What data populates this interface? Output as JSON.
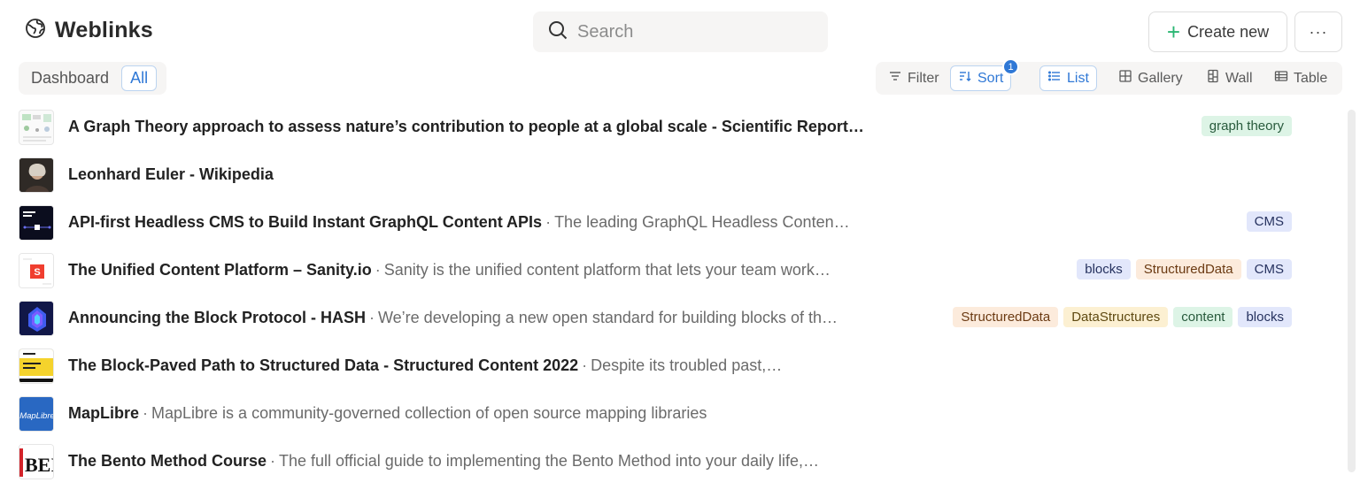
{
  "header": {
    "title": "Weblinks",
    "search_placeholder": "Search",
    "create_label": "Create new",
    "more_label": "···"
  },
  "views": {
    "tabs": [
      {
        "label": "Dashboard",
        "active": false
      },
      {
        "label": "All",
        "active": true
      }
    ]
  },
  "toolbar": {
    "filter_label": "Filter",
    "sort_label": "Sort",
    "sort_count": "1",
    "list_label": "List",
    "gallery_label": "Gallery",
    "wall_label": "Wall",
    "table_label": "Table"
  },
  "links": [
    {
      "title": "A Graph Theory approach to assess nature’s contribution to people at a global scale - Scientific Report…",
      "description": "",
      "tags": [
        {
          "label": "graph theory",
          "color": "green"
        }
      ]
    },
    {
      "title": "Leonhard Euler - Wikipedia",
      "description": "",
      "tags": []
    },
    {
      "title": "API-first Headless CMS to Build Instant GraphQL Content APIs",
      "description": "The leading GraphQL Headless Conten…",
      "tags": [
        {
          "label": "CMS",
          "color": "blue"
        }
      ]
    },
    {
      "title": "The Unified Content Platform – Sanity.io",
      "description": "Sanity is the unified content platform that lets your team work…",
      "tags": [
        {
          "label": "blocks",
          "color": "blue"
        },
        {
          "label": "StructuredData",
          "color": "orange"
        },
        {
          "label": "CMS",
          "color": "blue"
        }
      ]
    },
    {
      "title": "Announcing the Block Protocol - HASH",
      "description": "We’re developing a new open standard for building blocks of th…",
      "tags": [
        {
          "label": "StructuredData",
          "color": "orange"
        },
        {
          "label": "DataStructures",
          "color": "yellow"
        },
        {
          "label": "content",
          "color": "green"
        },
        {
          "label": "blocks",
          "color": "blue"
        }
      ]
    },
    {
      "title": "The Block-Paved Path to Structured Data - Structured Content 2022",
      "description": "Despite its troubled past,…",
      "tags": []
    },
    {
      "title": "MapLibre",
      "description": "MapLibre is a community-governed collection of open source mapping libraries",
      "tags": []
    },
    {
      "title": "The Bento Method Course",
      "description": "The full official guide to implementing the Bento Method into your daily life,…",
      "tags": []
    }
  ],
  "thumbnails": {
    "maplibre_text": "MapLibre",
    "bento_text": "BEI",
    "sanity_text": "S"
  }
}
